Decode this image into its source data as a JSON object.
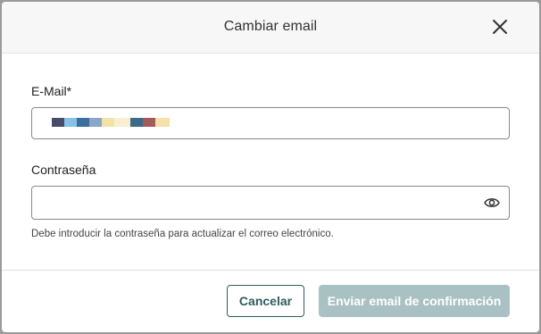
{
  "dialog": {
    "title": "Cambiar email",
    "close_icon": "close-icon"
  },
  "email": {
    "label": "E-Mail*",
    "value_redacted": true
  },
  "password": {
    "label": "Contraseña",
    "value": "",
    "toggle_icon": "eye-icon",
    "hint": "Debe introducir la contraseña para actualizar el correo electrónico."
  },
  "actions": {
    "cancel_label": "Cancelar",
    "confirm_label": "Enviar email de confirmación"
  },
  "colors": {
    "accent": "#2f5d5f",
    "confirm_disabled_bg": "#a9c1c3",
    "header_bg": "#f7f7f7"
  }
}
